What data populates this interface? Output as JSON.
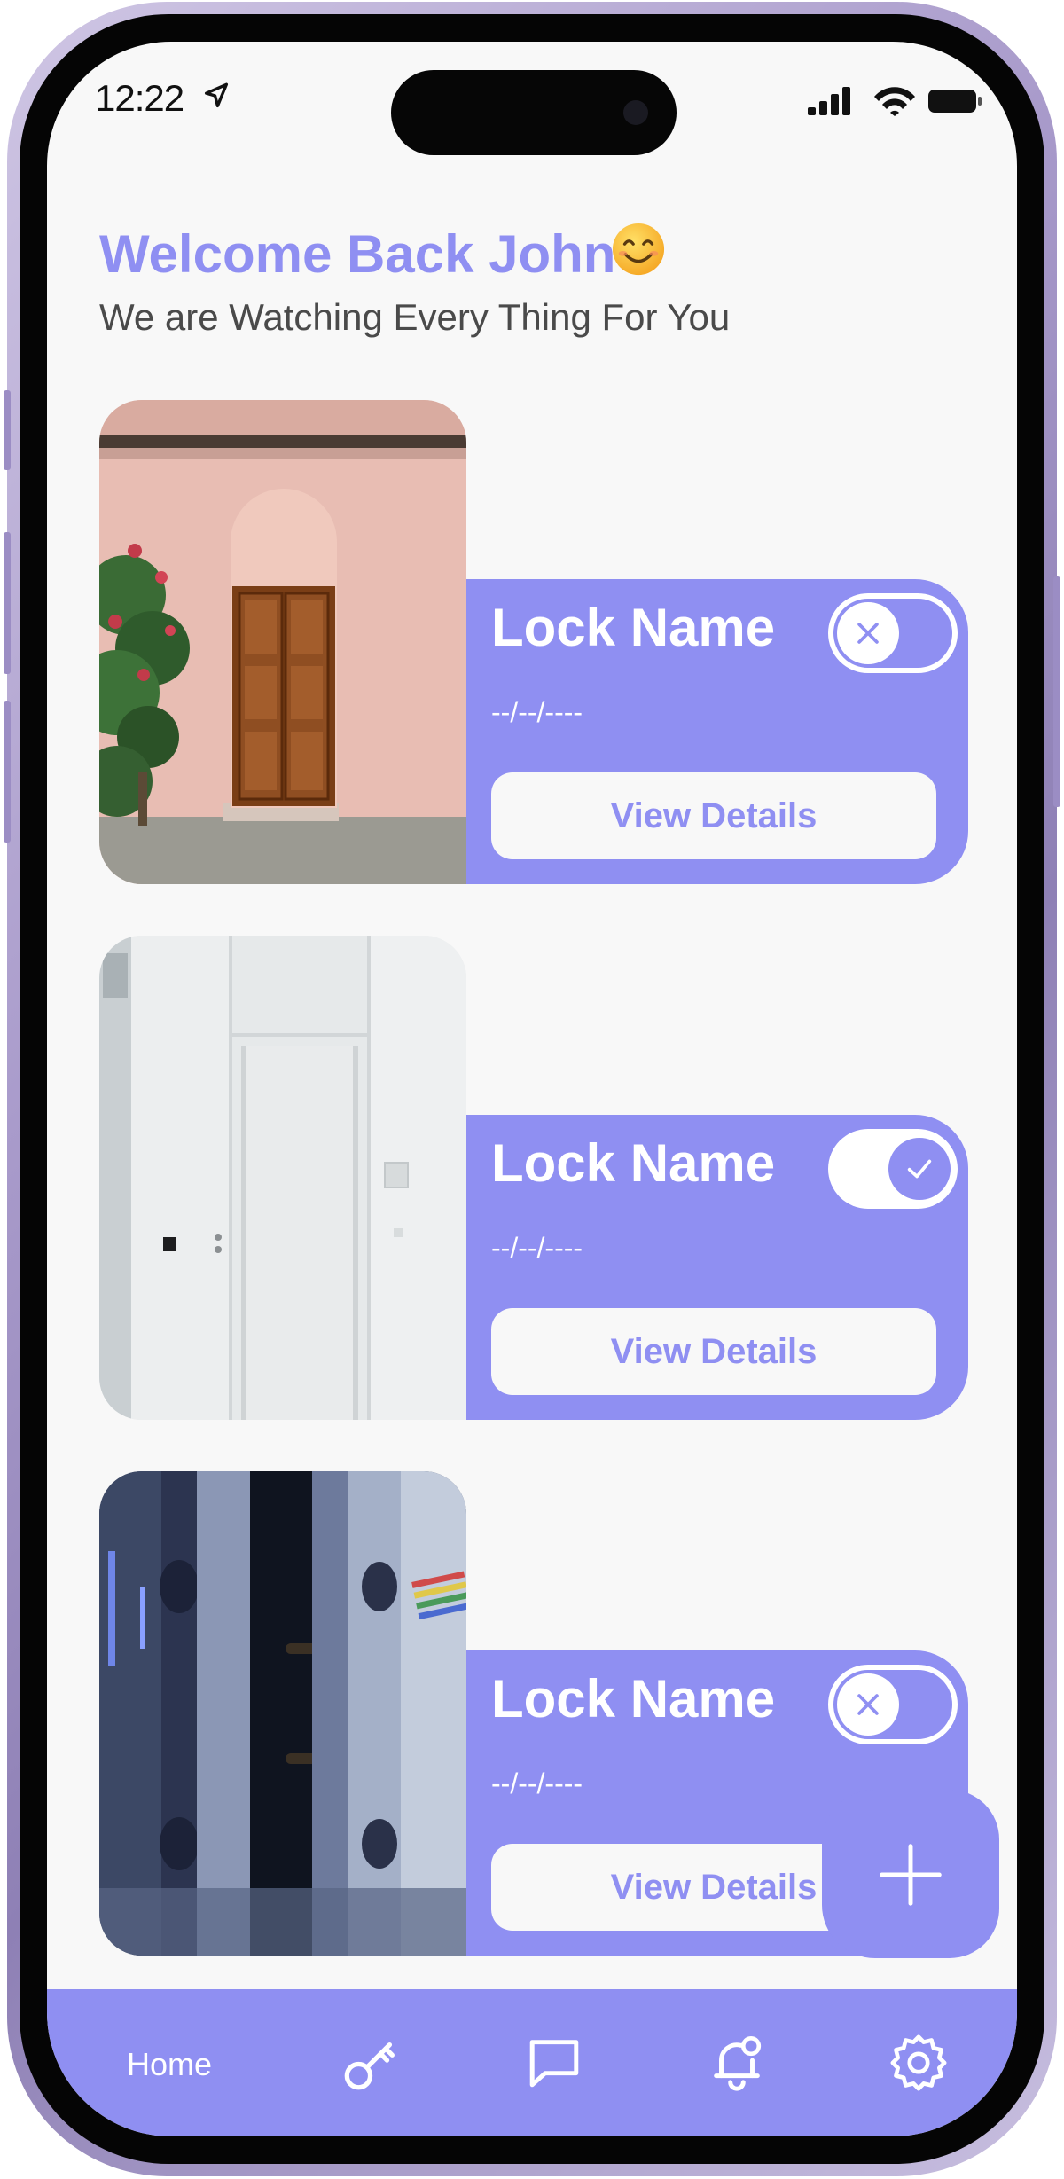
{
  "status_bar": {
    "time": "12:22"
  },
  "header": {
    "title": "Welcome Back John",
    "subtitle": "We are Watching Every Thing For You"
  },
  "locks": [
    {
      "name": "Lock Name",
      "date": "--/--/----",
      "button_label": "View Details",
      "enabled": false,
      "photo": "pink-wall-wooden-door"
    },
    {
      "name": "Lock Name",
      "date": "--/--/----",
      "button_label": "View Details",
      "enabled": true,
      "photo": "white-door"
    },
    {
      "name": "Lock Name",
      "date": "--/--/----",
      "button_label": "View Details",
      "enabled": false,
      "photo": "hallway-glass-door"
    }
  ],
  "bottom_nav": {
    "items": [
      {
        "label": "Home",
        "icon": "home"
      },
      {
        "label": "",
        "icon": "key-icon"
      },
      {
        "label": "",
        "icon": "chat-icon"
      },
      {
        "label": "",
        "icon": "bell-icon"
      },
      {
        "label": "",
        "icon": "gear-icon"
      }
    ]
  },
  "fab": {
    "icon": "plus-icon"
  },
  "colors": {
    "accent": "#8F8FF2",
    "background": "#F8F8F8",
    "text_dark": "#4A4A4A",
    "white": "#FFFFFF"
  }
}
